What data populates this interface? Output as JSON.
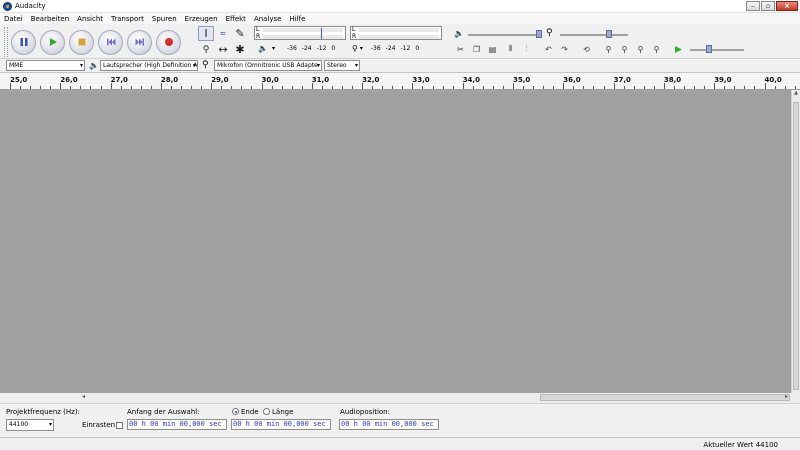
{
  "window": {
    "title": "Audacity"
  },
  "menu": [
    "Datei",
    "Bearbeiten",
    "Ansicht",
    "Transport",
    "Spuren",
    "Erzeugen",
    "Effekt",
    "Analyse",
    "Hilfe"
  ],
  "meters": {
    "lr_label_l": "L",
    "lr_label_r": "R",
    "playback_scale": [
      "-36",
      "-24",
      "-12",
      "0"
    ],
    "record_scale": [
      "-36",
      "-24",
      "-12",
      "0"
    ]
  },
  "device": {
    "host": "MME",
    "playback_device": "Lautsprecher (High Definition A",
    "record_device": "Mikrofon (Omnitronic USB Adapte",
    "channels": "Stereo"
  },
  "ruler": {
    "labels": [
      "25,0",
      "26,0",
      "27,0",
      "28,0",
      "29,0",
      "30,0",
      "31,0",
      "32,0",
      "33,0",
      "34,0",
      "35,0",
      "36,0",
      "37,0",
      "38,0",
      "39,0",
      "40,0"
    ]
  },
  "selection": {
    "project_rate_label": "Projektfrequenz (Hz):",
    "project_rate_value": "44100",
    "snap_label": "Einrasten",
    "start_label": "Anfang der Auswahl:",
    "end_label": "Ende",
    "length_label": "Länge",
    "audio_pos_label": "Audioposition:",
    "time_start": "00 h 00 min 00,000 sec",
    "time_end": "00 h 00 min 00,000 sec",
    "time_audio": "00 h 00 min 00,000 sec"
  },
  "status": {
    "text": "Aktueller Wert 44100"
  },
  "colors": {
    "track_bg": "#a0a0a0",
    "accent": "#2a3cc8",
    "record": "#d03030",
    "play": "#2fae2f"
  }
}
